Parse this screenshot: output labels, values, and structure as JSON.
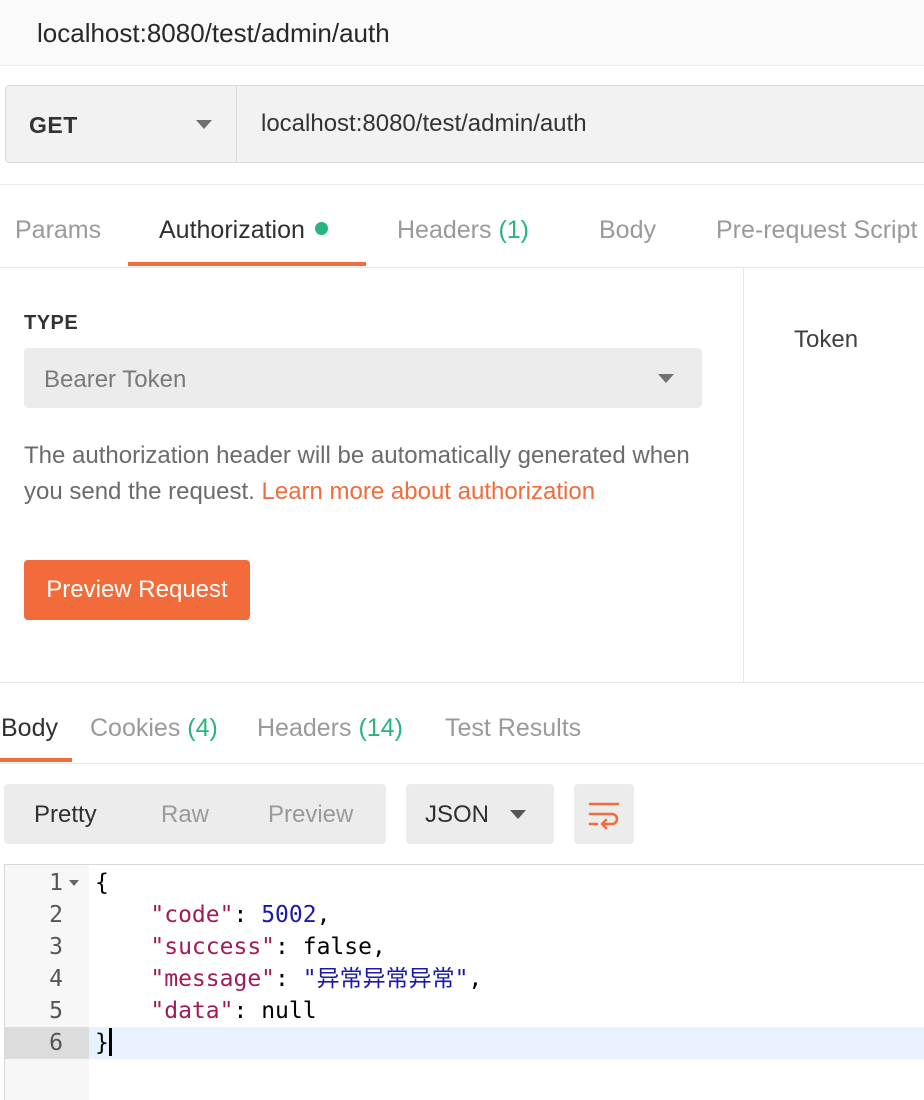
{
  "window": {
    "title": "localhost:8080/test/admin/auth"
  },
  "request": {
    "method": "GET",
    "url": "localhost:8080/test/admin/auth"
  },
  "request_tabs": [
    {
      "label": "Params"
    },
    {
      "label": "Authorization",
      "active": true,
      "indicator": "green-dot"
    },
    {
      "label": "Headers",
      "count": "(1)"
    },
    {
      "label": "Body"
    },
    {
      "label": "Pre-request Script"
    }
  ],
  "auth": {
    "type_label": "TYPE",
    "type_value": "Bearer Token",
    "help_text": "The authorization header will be automatically generated when you send the request.",
    "help_link": "Learn more about authorization",
    "preview_button": "Preview Request",
    "token_label": "Token"
  },
  "response_tabs": [
    {
      "label": "Body",
      "active": true
    },
    {
      "label": "Cookies",
      "count": "(4)"
    },
    {
      "label": "Headers",
      "count": "(14)"
    },
    {
      "label": "Test Results"
    }
  ],
  "response_view": {
    "modes": [
      "Pretty",
      "Raw",
      "Preview"
    ],
    "active_mode": "Pretty",
    "format": "JSON",
    "wrap_icon": "wrap-lines-icon"
  },
  "response_body": {
    "line_numbers": [
      "1",
      "2",
      "3",
      "4",
      "5",
      "6"
    ],
    "open_brace": "{",
    "close_brace": "}",
    "fields": [
      {
        "key": "\"code\"",
        "value": "5002"
      },
      {
        "key": "\"success\"",
        "value": "false"
      },
      {
        "key": "\"message\"",
        "value": "\"异常异常异常\""
      },
      {
        "key": "\"data\"",
        "value": "null"
      }
    ]
  },
  "colors": {
    "accent": "#f26b3a",
    "count_green": "#26b47f",
    "json_key": "#a11a5a",
    "json_value": "#1a1aa6",
    "current_line": "#e8f2fe"
  }
}
